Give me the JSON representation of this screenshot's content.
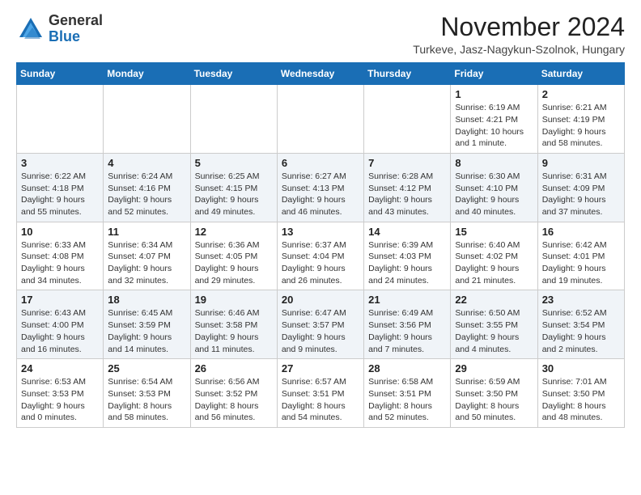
{
  "header": {
    "logo_general": "General",
    "logo_blue": "Blue",
    "month_title": "November 2024",
    "subtitle": "Turkeve, Jasz-Nagykun-Szolnok, Hungary"
  },
  "weekdays": [
    "Sunday",
    "Monday",
    "Tuesday",
    "Wednesday",
    "Thursday",
    "Friday",
    "Saturday"
  ],
  "weeks": [
    [
      {
        "day": "",
        "info": ""
      },
      {
        "day": "",
        "info": ""
      },
      {
        "day": "",
        "info": ""
      },
      {
        "day": "",
        "info": ""
      },
      {
        "day": "",
        "info": ""
      },
      {
        "day": "1",
        "info": "Sunrise: 6:19 AM\nSunset: 4:21 PM\nDaylight: 10 hours\nand 1 minute."
      },
      {
        "day": "2",
        "info": "Sunrise: 6:21 AM\nSunset: 4:19 PM\nDaylight: 9 hours\nand 58 minutes."
      }
    ],
    [
      {
        "day": "3",
        "info": "Sunrise: 6:22 AM\nSunset: 4:18 PM\nDaylight: 9 hours\nand 55 minutes."
      },
      {
        "day": "4",
        "info": "Sunrise: 6:24 AM\nSunset: 4:16 PM\nDaylight: 9 hours\nand 52 minutes."
      },
      {
        "day": "5",
        "info": "Sunrise: 6:25 AM\nSunset: 4:15 PM\nDaylight: 9 hours\nand 49 minutes."
      },
      {
        "day": "6",
        "info": "Sunrise: 6:27 AM\nSunset: 4:13 PM\nDaylight: 9 hours\nand 46 minutes."
      },
      {
        "day": "7",
        "info": "Sunrise: 6:28 AM\nSunset: 4:12 PM\nDaylight: 9 hours\nand 43 minutes."
      },
      {
        "day": "8",
        "info": "Sunrise: 6:30 AM\nSunset: 4:10 PM\nDaylight: 9 hours\nand 40 minutes."
      },
      {
        "day": "9",
        "info": "Sunrise: 6:31 AM\nSunset: 4:09 PM\nDaylight: 9 hours\nand 37 minutes."
      }
    ],
    [
      {
        "day": "10",
        "info": "Sunrise: 6:33 AM\nSunset: 4:08 PM\nDaylight: 9 hours\nand 34 minutes."
      },
      {
        "day": "11",
        "info": "Sunrise: 6:34 AM\nSunset: 4:07 PM\nDaylight: 9 hours\nand 32 minutes."
      },
      {
        "day": "12",
        "info": "Sunrise: 6:36 AM\nSunset: 4:05 PM\nDaylight: 9 hours\nand 29 minutes."
      },
      {
        "day": "13",
        "info": "Sunrise: 6:37 AM\nSunset: 4:04 PM\nDaylight: 9 hours\nand 26 minutes."
      },
      {
        "day": "14",
        "info": "Sunrise: 6:39 AM\nSunset: 4:03 PM\nDaylight: 9 hours\nand 24 minutes."
      },
      {
        "day": "15",
        "info": "Sunrise: 6:40 AM\nSunset: 4:02 PM\nDaylight: 9 hours\nand 21 minutes."
      },
      {
        "day": "16",
        "info": "Sunrise: 6:42 AM\nSunset: 4:01 PM\nDaylight: 9 hours\nand 19 minutes."
      }
    ],
    [
      {
        "day": "17",
        "info": "Sunrise: 6:43 AM\nSunset: 4:00 PM\nDaylight: 9 hours\nand 16 minutes."
      },
      {
        "day": "18",
        "info": "Sunrise: 6:45 AM\nSunset: 3:59 PM\nDaylight: 9 hours\nand 14 minutes."
      },
      {
        "day": "19",
        "info": "Sunrise: 6:46 AM\nSunset: 3:58 PM\nDaylight: 9 hours\nand 11 minutes."
      },
      {
        "day": "20",
        "info": "Sunrise: 6:47 AM\nSunset: 3:57 PM\nDaylight: 9 hours\nand 9 minutes."
      },
      {
        "day": "21",
        "info": "Sunrise: 6:49 AM\nSunset: 3:56 PM\nDaylight: 9 hours\nand 7 minutes."
      },
      {
        "day": "22",
        "info": "Sunrise: 6:50 AM\nSunset: 3:55 PM\nDaylight: 9 hours\nand 4 minutes."
      },
      {
        "day": "23",
        "info": "Sunrise: 6:52 AM\nSunset: 3:54 PM\nDaylight: 9 hours\nand 2 minutes."
      }
    ],
    [
      {
        "day": "24",
        "info": "Sunrise: 6:53 AM\nSunset: 3:53 PM\nDaylight: 9 hours\nand 0 minutes."
      },
      {
        "day": "25",
        "info": "Sunrise: 6:54 AM\nSunset: 3:53 PM\nDaylight: 8 hours\nand 58 minutes."
      },
      {
        "day": "26",
        "info": "Sunrise: 6:56 AM\nSunset: 3:52 PM\nDaylight: 8 hours\nand 56 minutes."
      },
      {
        "day": "27",
        "info": "Sunrise: 6:57 AM\nSunset: 3:51 PM\nDaylight: 8 hours\nand 54 minutes."
      },
      {
        "day": "28",
        "info": "Sunrise: 6:58 AM\nSunset: 3:51 PM\nDaylight: 8 hours\nand 52 minutes."
      },
      {
        "day": "29",
        "info": "Sunrise: 6:59 AM\nSunset: 3:50 PM\nDaylight: 8 hours\nand 50 minutes."
      },
      {
        "day": "30",
        "info": "Sunrise: 7:01 AM\nSunset: 3:50 PM\nDaylight: 8 hours\nand 48 minutes."
      }
    ]
  ]
}
